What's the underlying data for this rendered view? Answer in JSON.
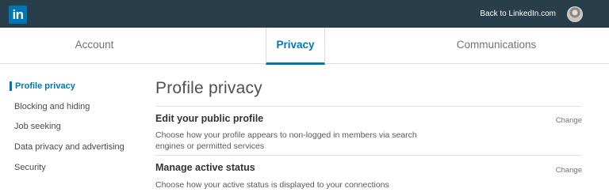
{
  "header": {
    "logo_text": "in",
    "back_link": "Back to LinkedIn.com"
  },
  "tabs": [
    {
      "label": "Account"
    },
    {
      "label": "Privacy"
    },
    {
      "label": "Communications"
    }
  ],
  "sidebar": {
    "items": [
      {
        "label": "Profile privacy"
      },
      {
        "label": "Blocking and hiding"
      },
      {
        "label": "Job seeking"
      },
      {
        "label": "Data privacy and advertising"
      },
      {
        "label": "Security"
      }
    ]
  },
  "main": {
    "title": "Profile privacy",
    "sections": [
      {
        "title": "Edit your public profile",
        "description": "Choose how your profile appears to non-logged in members via search engines or permitted services",
        "action": "Change"
      },
      {
        "title": "Manage active status",
        "description": "Choose how your active status is displayed to your connections",
        "action": "Change"
      }
    ]
  },
  "colors": {
    "topbar": "#283e4a",
    "brand": "#0077b5"
  }
}
